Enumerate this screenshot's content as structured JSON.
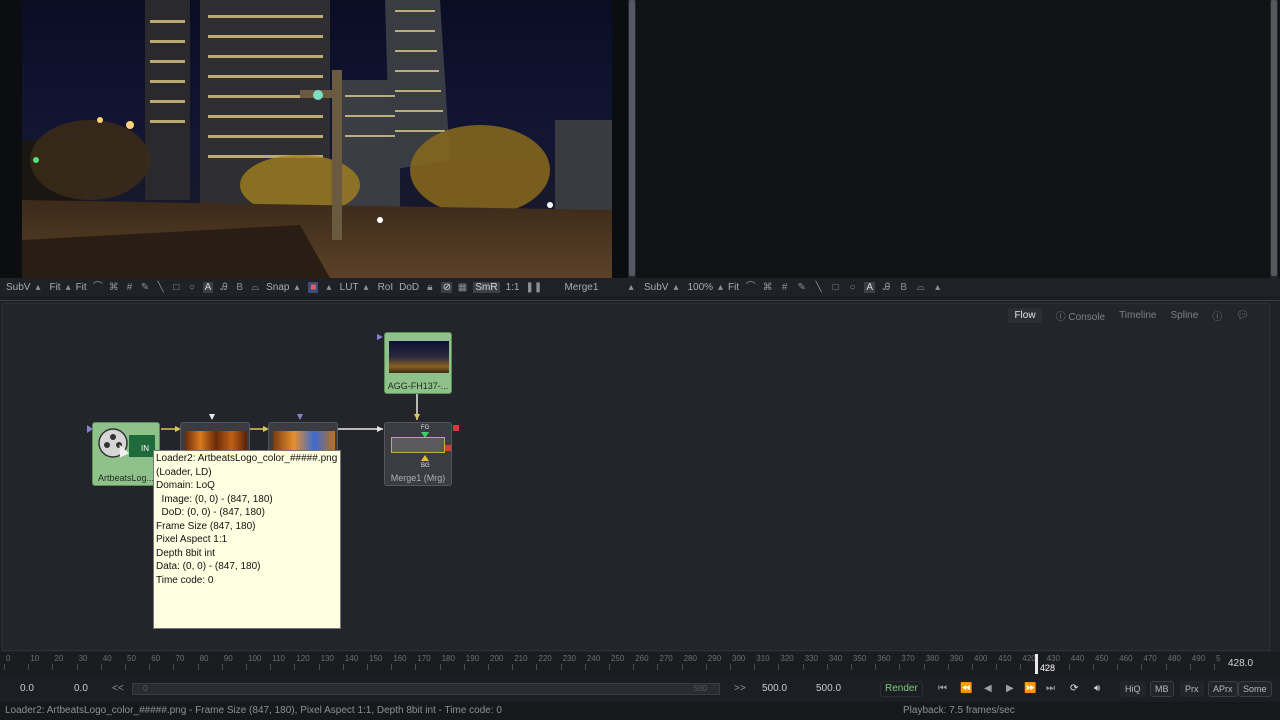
{
  "viewers": {
    "left_toolbar": {
      "subv": "SubV",
      "fit1": "Fit",
      "fit2": "Fit",
      "snap": "Snap",
      "lut": "LUT",
      "roi": "RoI",
      "dod": "DoD",
      "smr": "SmR",
      "ratio": "1:1",
      "view_name": "Merge1"
    },
    "right_toolbar": {
      "subv": "SubV",
      "zoom": "100%",
      "fit": "Fit"
    }
  },
  "flow": {
    "tabs": [
      "Flow",
      "Console",
      "Timeline",
      "Spline"
    ],
    "active_tab": "Flow",
    "nodes": {
      "loader_caption": "ArtbeatsLog...",
      "agg_caption": "AGG-FH137-...",
      "merge_caption": "Merge1 (Mrg)",
      "merge_fg": "FG",
      "merge_bg": "BG"
    }
  },
  "tooltip": {
    "lines": [
      "Loader2: ArtbeatsLogo_color_#####.png",
      "(Loader, LD)",
      "",
      "Domain: LoQ",
      "  Image: (0, 0) - (847, 180)",
      "  DoD: (0, 0) - (847, 180)",
      "",
      "Frame Size (847, 180)",
      "Pixel Aspect 1:1",
      "Depth 8bit int",
      "Data: (0, 0) - (847, 180)",
      "",
      "Time code: 0"
    ]
  },
  "timeline": {
    "ticks": [
      "0",
      "10",
      "20",
      "30",
      "40",
      "50",
      "60",
      "70",
      "80",
      "90",
      "100",
      "110",
      "120",
      "130",
      "140",
      "150",
      "160",
      "170",
      "180",
      "190",
      "200",
      "210",
      "220",
      "230",
      "240",
      "250",
      "260",
      "270",
      "280",
      "290",
      "300",
      "310",
      "320",
      "330",
      "340",
      "350",
      "360",
      "370",
      "380",
      "390",
      "400",
      "410",
      "420",
      "430",
      "440",
      "450",
      "460",
      "470",
      "480",
      "490",
      "5"
    ],
    "current_frame": "428",
    "current_frame_display": "428.0"
  },
  "transport": {
    "global_start": "0.0",
    "render_start": "0.0",
    "back_label": "<<",
    "slider_start": "0",
    "slider_end": "500",
    "forward_label": ">>",
    "render_end": "500.0",
    "global_end": "500.0",
    "render_button": "Render",
    "hiq": "HiQ",
    "mb": "MB",
    "prx": "Prx",
    "aprx": "APrx",
    "some": "Some"
  },
  "status": {
    "message": "Loader2: ArtbeatsLogo_color_#####.png - Frame Size (847, 180), Pixel Aspect 1:1, Depth 8bit int - Time code: 0",
    "playback": "Playback: 7.5 frames/sec"
  },
  "colors": {
    "accent_green": "#7fb37a",
    "tooltip_bg": "#ffffe1",
    "render_text": "#7ad07a"
  }
}
